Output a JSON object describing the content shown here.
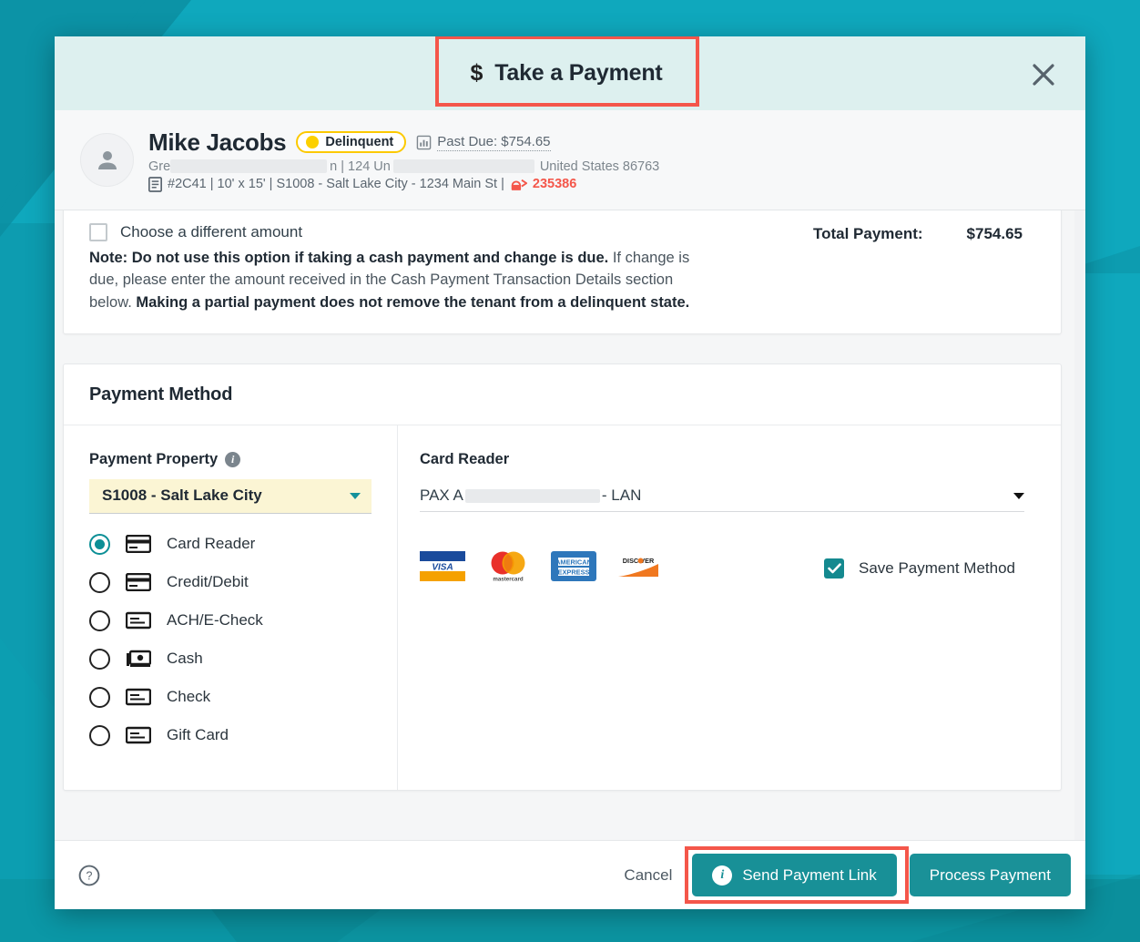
{
  "window": {
    "background_accent": "#0fa8bd",
    "background_accent_dark": "#0b7f8c"
  },
  "header": {
    "title": "Take a Payment",
    "currency_glyph": "$",
    "close_label": "Close",
    "highlight_color": "#f4564a",
    "background": "#ddf0ef"
  },
  "tenant": {
    "name": "Mike Jacobs",
    "status_badge": "Delinquent",
    "status_color": "#fcd000",
    "past_due_label": "Past Due: $754.65",
    "address_prefix": "Gre",
    "address_mid_1": "n | 124 Un",
    "address_suffix": "United States 86763",
    "unit_details": "#2C41 | 10' x 15' | S1008 - Salt Lake City - 1234 Main St |",
    "lock_code": "235386",
    "lock_color": "#f4564a"
  },
  "amount_section": {
    "different_amount_label": "Choose a different amount",
    "different_amount_checked": false,
    "note_part1_bold": "Note: Do not use this option if taking a cash payment and change is due.",
    "note_part2": " If change is due, please enter the amount received in the Cash Payment Transaction Details section below. ",
    "note_part3_bold": "Making a partial payment does not remove the tenant from a delinquent state.",
    "total_label": "Total Payment:",
    "total_value": "$754.65"
  },
  "payment_method": {
    "section_title": "Payment Method",
    "property_label": "Payment Property",
    "property_info_icon": "info-icon",
    "property_value": "S1008 - Salt Lake City",
    "property_autofill_color": "#fbf5d4",
    "options": [
      {
        "label": "Card Reader",
        "icon": "credit-card-icon",
        "selected": true
      },
      {
        "label": "Credit/Debit",
        "icon": "credit-card-icon",
        "selected": false
      },
      {
        "label": "ACH/E-Check",
        "icon": "check-icon",
        "selected": false
      },
      {
        "label": "Cash",
        "icon": "cash-icon",
        "selected": false
      },
      {
        "label": "Check",
        "icon": "check-icon",
        "selected": false
      },
      {
        "label": "Gift Card",
        "icon": "gift-card-icon",
        "selected": false
      }
    ],
    "reader_label": "Card Reader",
    "reader_value_prefix": "PAX A",
    "reader_value_suffix": "- LAN",
    "card_brands": [
      "visa",
      "mastercard",
      "american-express",
      "discover"
    ],
    "save_method_label": "Save Payment Method",
    "save_method_checked": true,
    "save_checkbox_color": "#14898f"
  },
  "footer": {
    "help_icon": "help-circle-icon",
    "cancel_label": "Cancel",
    "send_link_label": "Send Payment Link",
    "process_label": "Process Payment",
    "button_color": "#189097",
    "highlight_color": "#f4564a"
  }
}
